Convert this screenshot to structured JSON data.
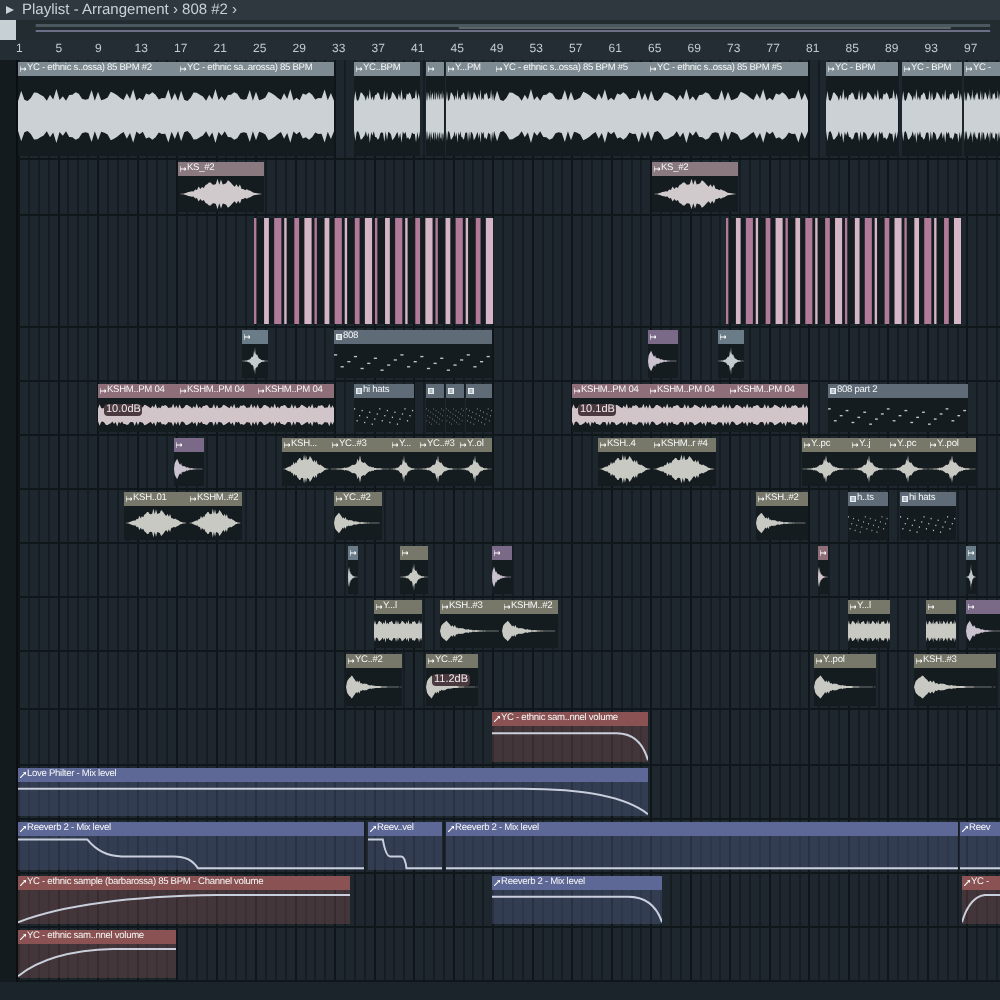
{
  "window": {
    "title": "Playlist - Arrangement › 808 #2 ›"
  },
  "ruler": [
    "1",
    "5",
    "9",
    "13",
    "17",
    "21",
    "25",
    "29",
    "33",
    "37",
    "41",
    "45",
    "49",
    "53",
    "57",
    "61",
    "65",
    "69",
    "73",
    "77",
    "81",
    "85",
    "89",
    "93",
    "97"
  ],
  "tracks": [
    {
      "clips": [
        {
          "kind": "sustain",
          "label": "YC - ethnic s..ossa) 85 BPM #2",
          "color": "#7e8b93"
        },
        {
          "kind": "sustain",
          "label": "YC - ethnic sa..arossa) 85 BPM",
          "color": "#7e8b93"
        },
        {
          "kind": "sustain",
          "label": "YC..BPM",
          "color": "#7e8b93"
        },
        {
          "kind": "sustain",
          "color": "#7e8b93"
        },
        {
          "kind": "sustain",
          "label": "Y...PM",
          "color": "#7e8b93"
        },
        {
          "kind": "sustain",
          "label": "YC - ethnic s..ossa) 85 BPM #5",
          "color": "#7e8b93"
        },
        {
          "kind": "sustain",
          "label": "YC - ethnic s..ossa) 85 BPM #5",
          "color": "#7e8b93"
        },
        {
          "kind": "sustain",
          "label": "YC - BPM",
          "color": "#7e8b93"
        },
        {
          "kind": "sustain",
          "label": "YC - BPM",
          "color": "#7e8b93"
        },
        {
          "kind": "sustain",
          "label": "YC -",
          "color": "#7e8b93"
        }
      ]
    },
    {
      "clips": [
        {
          "kind": "swell",
          "label": "KS_#2",
          "color": "#8a7a80"
        },
        {
          "kind": "swell",
          "label": "KS_#2",
          "color": "#8a7a80"
        }
      ]
    },
    {
      "clips": [
        {
          "kind": "notes",
          "color": "#b07a98"
        },
        {
          "kind": "notes",
          "color": "#b07a98"
        }
      ]
    },
    {
      "clips": [
        {
          "kind": "burst",
          "color": "#6a7c88"
        },
        {
          "kind": "pattern",
          "label": "808",
          "color": "#5f6c78"
        },
        {
          "kind": "decay",
          "color": "#7a6a88"
        },
        {
          "kind": "burst",
          "color": "#6a7c88"
        }
      ]
    },
    {
      "clips": [
        {
          "kind": "sustain",
          "label": "KSHM..PM 04",
          "gain": "10.0dB",
          "color": "#8e6e78"
        },
        {
          "kind": "sustain",
          "label": "KSHM..PM 04",
          "color": "#8e6e78"
        },
        {
          "kind": "sustain",
          "label": "KSHM..PM 04",
          "color": "#8e6e78"
        },
        {
          "kind": "pattern",
          "label": "hi hats",
          "color": "#5f6c78"
        },
        {
          "kind": "pattern",
          "color": "#5f6c78"
        },
        {
          "kind": "pattern",
          "color": "#5f6c78"
        },
        {
          "kind": "pattern",
          "color": "#5f6c78"
        },
        {
          "kind": "sustain",
          "label": "KSHM..PM 04",
          "gain": "10.1dB",
          "color": "#8e6e78"
        },
        {
          "kind": "sustain",
          "label": "KSHM..PM 04",
          "color": "#8e6e78"
        },
        {
          "kind": "sustain",
          "label": "KSHM..PM 04",
          "color": "#8e6e78"
        },
        {
          "kind": "pattern",
          "label": "808 part 2",
          "color": "#5f6c78"
        }
      ]
    },
    {
      "clips": [
        {
          "kind": "decay",
          "color": "#7a6a88"
        },
        {
          "kind": "swell",
          "label": "KSH...",
          "color": "#77786a"
        },
        {
          "kind": "burst",
          "label": "YC..#3",
          "color": "#77786a"
        },
        {
          "kind": "burst",
          "label": "Y...",
          "color": "#77786a"
        },
        {
          "kind": "burst",
          "label": "YC..#3",
          "color": "#77786a"
        },
        {
          "kind": "burst",
          "label": "Y..ol",
          "color": "#77786a"
        },
        {
          "kind": "swell",
          "label": "KSH..4",
          "color": "#77786a"
        },
        {
          "kind": "swell",
          "label": "KSHM..r #4",
          "color": "#77786a"
        },
        {
          "kind": "burst",
          "label": "Y..pc",
          "color": "#77786a"
        },
        {
          "kind": "burst",
          "label": "Y..j",
          "color": "#77786a"
        },
        {
          "kind": "burst",
          "label": "Y..pc",
          "color": "#77786a"
        },
        {
          "kind": "burst",
          "label": "Y..pol",
          "color": "#77786a"
        }
      ]
    },
    {
      "clips": [
        {
          "kind": "swell",
          "label": "KSH..01",
          "color": "#77786a"
        },
        {
          "kind": "swell",
          "label": "KSHM..#2",
          "color": "#77786a"
        },
        {
          "kind": "decay",
          "label": "YC..#2",
          "color": "#77786a"
        },
        {
          "kind": "decay",
          "label": "KSH..#2",
          "color": "#77786a"
        },
        {
          "kind": "pattern",
          "label": "h..ts",
          "color": "#5f6c78"
        },
        {
          "kind": "pattern",
          "label": "hi hats",
          "color": "#5f6c78"
        }
      ]
    },
    {
      "clips": [
        {
          "kind": "decay",
          "color": "#6a7c88"
        },
        {
          "kind": "burst",
          "color": "#77786a"
        },
        {
          "kind": "decay",
          "color": "#7a6a88"
        },
        {
          "kind": "decay",
          "color": "#8e6e78"
        },
        {
          "kind": "burst",
          "color": "#6a7c88"
        }
      ]
    },
    {
      "clips": [
        {
          "kind": "sustain",
          "label": "Y...l",
          "color": "#77786a"
        },
        {
          "kind": "decay",
          "label": "KSH..#3",
          "color": "#77786a"
        },
        {
          "kind": "decay",
          "label": "KSHM..#2",
          "color": "#77786a"
        },
        {
          "kind": "sustain",
          "label": "Y...l",
          "color": "#77786a"
        },
        {
          "kind": "sustain",
          "color": "#77786a"
        },
        {
          "kind": "decay",
          "color": "#7a6a88"
        }
      ]
    },
    {
      "clips": [
        {
          "kind": "decay",
          "label": "YC..#2",
          "color": "#77786a"
        },
        {
          "kind": "decay",
          "label": "YC..#2",
          "gain": "11.2dB",
          "color": "#77786a"
        },
        {
          "kind": "decay",
          "label": "Y..pol",
          "color": "#77786a"
        },
        {
          "kind": "decay",
          "label": "KSH..#3",
          "color": "#77786a"
        }
      ]
    },
    {
      "clips": [
        {
          "kind": "fall",
          "label": "YC - ethnic sam..nnel volume",
          "color": "#8a5252"
        }
      ]
    },
    {
      "clips": [
        {
          "kind": "fall",
          "label": "Love Philter - Mix level",
          "color": "#5d6896"
        }
      ]
    },
    {
      "clips": [
        {
          "kind": "dip",
          "label": "Reeverb 2 - Mix level",
          "color": "#5d6896"
        },
        {
          "kind": "dip",
          "label": "Reev..vel",
          "color": "#5d6896"
        },
        {
          "kind": "flat",
          "label": "Reeverb 2 - Mix level",
          "color": "#5d6896"
        },
        {
          "kind": "flat",
          "label": "Reev",
          "color": "#5d6896"
        }
      ]
    },
    {
      "clips": [
        {
          "kind": "rise",
          "label": "YC - ethnic sample (barbarossa) 85 BPM - Channel volume",
          "color": "#8a5252"
        },
        {
          "kind": "fall",
          "label": "Reeverb 2 - Mix level",
          "color": "#5d6896"
        },
        {
          "kind": "rise",
          "label": "YC -",
          "color": "#8a5252"
        }
      ]
    },
    {
      "clips": [
        {
          "kind": "rise",
          "label": "YC - ethnic sam..nnel volume",
          "color": "#8a5252"
        }
      ]
    }
  ]
}
